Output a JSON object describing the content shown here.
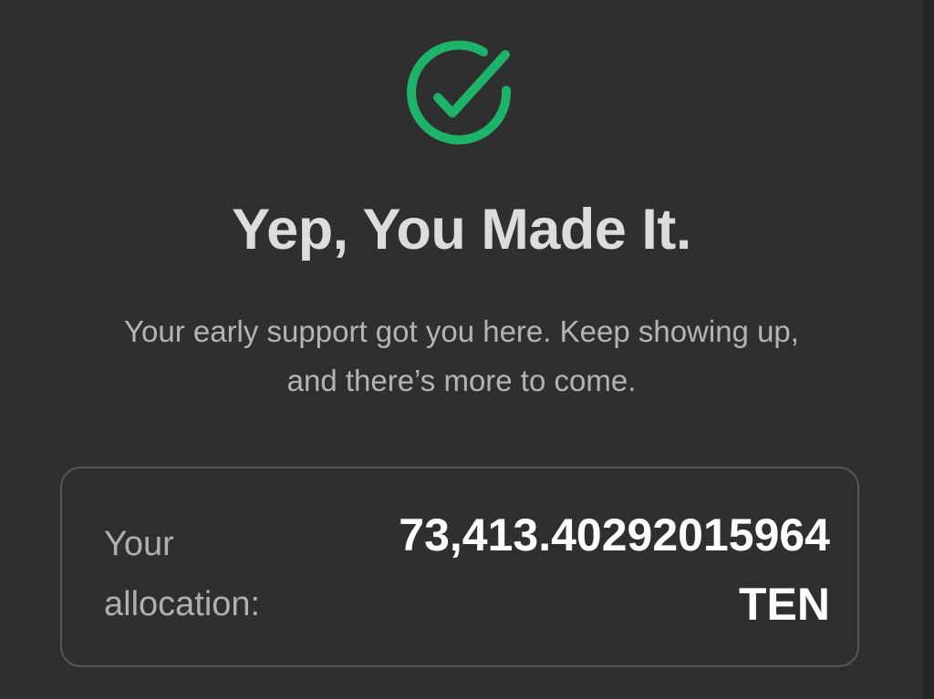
{
  "accent_color": "#1db368",
  "status_icon": "check-circle-icon",
  "heading": "Yep, You Made It.",
  "message_line1": "Your early support got you here. Keep showing up,",
  "message_line2": "and there’s more to come.",
  "allocation": {
    "label": "Your allocation:",
    "amount": "73,413.40292015964",
    "token": "TEN"
  }
}
